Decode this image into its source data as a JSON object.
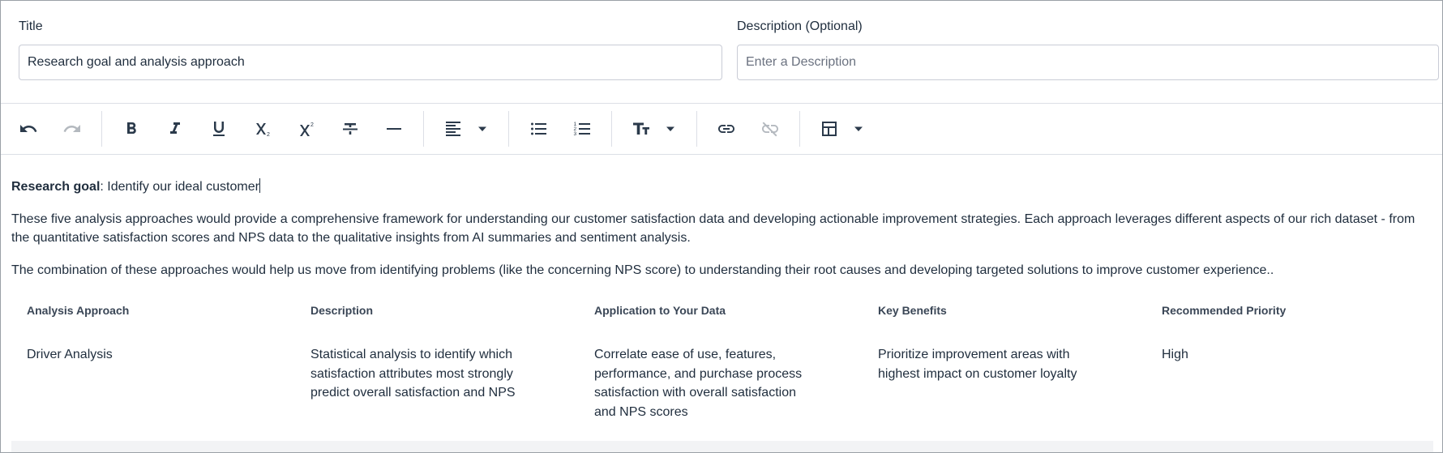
{
  "form": {
    "title_label": "Title",
    "title_value": "Research goal and analysis approach",
    "description_label": "Description (Optional)",
    "description_value": "",
    "description_placeholder": "Enter a Description"
  },
  "toolbar": {
    "buttons": [
      {
        "name": "undo",
        "icon": "undo-icon",
        "enabled": true
      },
      {
        "name": "redo",
        "icon": "redo-icon",
        "enabled": false
      },
      {
        "name": "bold",
        "icon": "bold-icon",
        "enabled": true
      },
      {
        "name": "italic",
        "icon": "italic-icon",
        "enabled": true
      },
      {
        "name": "underline",
        "icon": "underline-icon",
        "enabled": true
      },
      {
        "name": "subscript",
        "icon": "subscript-icon",
        "enabled": true
      },
      {
        "name": "superscript",
        "icon": "superscript-icon",
        "enabled": true
      },
      {
        "name": "strikethrough",
        "icon": "strikethrough-icon",
        "enabled": true
      },
      {
        "name": "horizontal-rule",
        "icon": "horizontal-rule-icon",
        "enabled": true
      },
      {
        "name": "align",
        "icon": "align-left-icon",
        "enabled": true
      },
      {
        "name": "bullet-list",
        "icon": "bullet-list-icon",
        "enabled": true
      },
      {
        "name": "numbered-list",
        "icon": "numbered-list-icon",
        "enabled": true
      },
      {
        "name": "text-size",
        "icon": "text-size-icon",
        "enabled": true
      },
      {
        "name": "link",
        "icon": "link-icon",
        "enabled": true
      },
      {
        "name": "unlink",
        "icon": "unlink-icon",
        "enabled": false
      },
      {
        "name": "table",
        "icon": "table-icon",
        "enabled": true
      }
    ]
  },
  "content": {
    "goal_label": "Research goal",
    "goal_text": ": Identify our ideal customer",
    "paragraph1": "These five analysis approaches would provide a comprehensive framework for understanding our customer satisfaction data and developing actionable improvement strategies. Each approach leverages different aspects of our rich dataset - from the quantitative satisfaction scores and NPS data to the qualitative insights from AI summaries and sentiment analysis.",
    "paragraph2": "The combination of these approaches would help us move from identifying problems (like the concerning NPS score) to understanding their root causes and developing targeted solutions to improve customer experience..",
    "table": {
      "headers": [
        "Analysis Approach",
        "Description",
        "Application to Your Data",
        "Key Benefits",
        "Recommended Priority"
      ],
      "rows": [
        [
          "Driver Analysis",
          "Statistical analysis to identify which satisfaction attributes most strongly predict overall satisfaction and NPS",
          "Correlate ease of use, features, performance, and purchase process satisfaction with overall satisfaction and NPS scores",
          "Prioritize improvement areas with highest impact on customer loyalty",
          "High"
        ]
      ]
    }
  },
  "colors": {
    "text": "#1f2d3d",
    "border": "#c9ccd6",
    "divider": "#dcdfe6",
    "icon": "#2b3a4b"
  }
}
